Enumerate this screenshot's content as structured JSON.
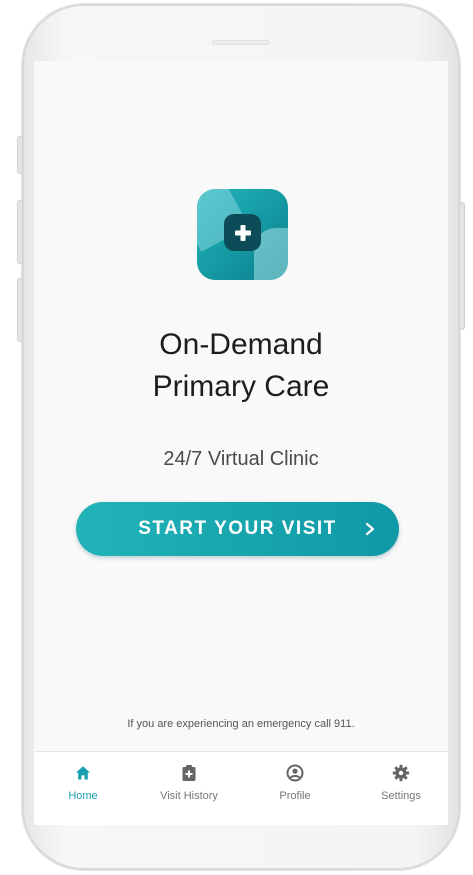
{
  "app": {
    "icon_name": "medical-plus-app-icon",
    "title_line1": "On-Demand",
    "title_line2": "Primary Care",
    "subtitle": "24/7 Virtual Clinic"
  },
  "cta": {
    "label": "START YOUR VISIT",
    "icon": "chevron-right-icon"
  },
  "notice": {
    "emergency": "If you are experiencing an emergency call 911."
  },
  "tabbar": {
    "active_tab": "Home",
    "items": [
      {
        "label": "Home",
        "icon": "home-icon"
      },
      {
        "label": "Visit History",
        "icon": "clipboard-plus-icon"
      },
      {
        "label": "Profile",
        "icon": "user-circle-icon"
      },
      {
        "label": "Settings",
        "icon": "gear-icon"
      }
    ]
  },
  "colors": {
    "accent": "#1a9fae",
    "button_gradient_start": "#22b3b9",
    "button_gradient_end": "#0f98a6",
    "icon_dark": "#0c4c59",
    "tab_inactive": "#777777",
    "text_dark": "#1d1d1d"
  }
}
